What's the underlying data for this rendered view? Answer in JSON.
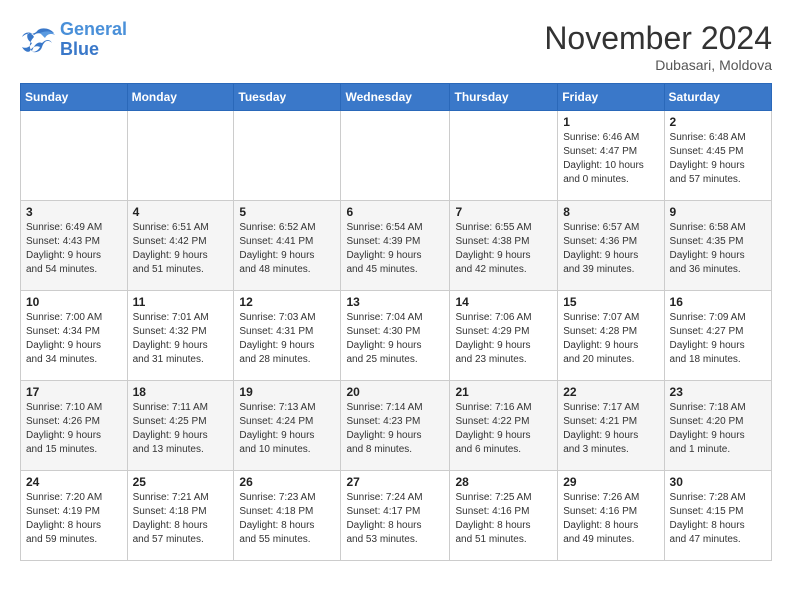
{
  "logo": {
    "line1": "General",
    "line2": "Blue"
  },
  "title": "November 2024",
  "location": "Dubasari, Moldova",
  "days_header": [
    "Sunday",
    "Monday",
    "Tuesday",
    "Wednesday",
    "Thursday",
    "Friday",
    "Saturday"
  ],
  "weeks": [
    [
      {
        "day": "",
        "info": ""
      },
      {
        "day": "",
        "info": ""
      },
      {
        "day": "",
        "info": ""
      },
      {
        "day": "",
        "info": ""
      },
      {
        "day": "",
        "info": ""
      },
      {
        "day": "1",
        "info": "Sunrise: 6:46 AM\nSunset: 4:47 PM\nDaylight: 10 hours\nand 0 minutes."
      },
      {
        "day": "2",
        "info": "Sunrise: 6:48 AM\nSunset: 4:45 PM\nDaylight: 9 hours\nand 57 minutes."
      }
    ],
    [
      {
        "day": "3",
        "info": "Sunrise: 6:49 AM\nSunset: 4:43 PM\nDaylight: 9 hours\nand 54 minutes."
      },
      {
        "day": "4",
        "info": "Sunrise: 6:51 AM\nSunset: 4:42 PM\nDaylight: 9 hours\nand 51 minutes."
      },
      {
        "day": "5",
        "info": "Sunrise: 6:52 AM\nSunset: 4:41 PM\nDaylight: 9 hours\nand 48 minutes."
      },
      {
        "day": "6",
        "info": "Sunrise: 6:54 AM\nSunset: 4:39 PM\nDaylight: 9 hours\nand 45 minutes."
      },
      {
        "day": "7",
        "info": "Sunrise: 6:55 AM\nSunset: 4:38 PM\nDaylight: 9 hours\nand 42 minutes."
      },
      {
        "day": "8",
        "info": "Sunrise: 6:57 AM\nSunset: 4:36 PM\nDaylight: 9 hours\nand 39 minutes."
      },
      {
        "day": "9",
        "info": "Sunrise: 6:58 AM\nSunset: 4:35 PM\nDaylight: 9 hours\nand 36 minutes."
      }
    ],
    [
      {
        "day": "10",
        "info": "Sunrise: 7:00 AM\nSunset: 4:34 PM\nDaylight: 9 hours\nand 34 minutes."
      },
      {
        "day": "11",
        "info": "Sunrise: 7:01 AM\nSunset: 4:32 PM\nDaylight: 9 hours\nand 31 minutes."
      },
      {
        "day": "12",
        "info": "Sunrise: 7:03 AM\nSunset: 4:31 PM\nDaylight: 9 hours\nand 28 minutes."
      },
      {
        "day": "13",
        "info": "Sunrise: 7:04 AM\nSunset: 4:30 PM\nDaylight: 9 hours\nand 25 minutes."
      },
      {
        "day": "14",
        "info": "Sunrise: 7:06 AM\nSunset: 4:29 PM\nDaylight: 9 hours\nand 23 minutes."
      },
      {
        "day": "15",
        "info": "Sunrise: 7:07 AM\nSunset: 4:28 PM\nDaylight: 9 hours\nand 20 minutes."
      },
      {
        "day": "16",
        "info": "Sunrise: 7:09 AM\nSunset: 4:27 PM\nDaylight: 9 hours\nand 18 minutes."
      }
    ],
    [
      {
        "day": "17",
        "info": "Sunrise: 7:10 AM\nSunset: 4:26 PM\nDaylight: 9 hours\nand 15 minutes."
      },
      {
        "day": "18",
        "info": "Sunrise: 7:11 AM\nSunset: 4:25 PM\nDaylight: 9 hours\nand 13 minutes."
      },
      {
        "day": "19",
        "info": "Sunrise: 7:13 AM\nSunset: 4:24 PM\nDaylight: 9 hours\nand 10 minutes."
      },
      {
        "day": "20",
        "info": "Sunrise: 7:14 AM\nSunset: 4:23 PM\nDaylight: 9 hours\nand 8 minutes."
      },
      {
        "day": "21",
        "info": "Sunrise: 7:16 AM\nSunset: 4:22 PM\nDaylight: 9 hours\nand 6 minutes."
      },
      {
        "day": "22",
        "info": "Sunrise: 7:17 AM\nSunset: 4:21 PM\nDaylight: 9 hours\nand 3 minutes."
      },
      {
        "day": "23",
        "info": "Sunrise: 7:18 AM\nSunset: 4:20 PM\nDaylight: 9 hours\nand 1 minute."
      }
    ],
    [
      {
        "day": "24",
        "info": "Sunrise: 7:20 AM\nSunset: 4:19 PM\nDaylight: 8 hours\nand 59 minutes."
      },
      {
        "day": "25",
        "info": "Sunrise: 7:21 AM\nSunset: 4:18 PM\nDaylight: 8 hours\nand 57 minutes."
      },
      {
        "day": "26",
        "info": "Sunrise: 7:23 AM\nSunset: 4:18 PM\nDaylight: 8 hours\nand 55 minutes."
      },
      {
        "day": "27",
        "info": "Sunrise: 7:24 AM\nSunset: 4:17 PM\nDaylight: 8 hours\nand 53 minutes."
      },
      {
        "day": "28",
        "info": "Sunrise: 7:25 AM\nSunset: 4:16 PM\nDaylight: 8 hours\nand 51 minutes."
      },
      {
        "day": "29",
        "info": "Sunrise: 7:26 AM\nSunset: 4:16 PM\nDaylight: 8 hours\nand 49 minutes."
      },
      {
        "day": "30",
        "info": "Sunrise: 7:28 AM\nSunset: 4:15 PM\nDaylight: 8 hours\nand 47 minutes."
      }
    ]
  ]
}
